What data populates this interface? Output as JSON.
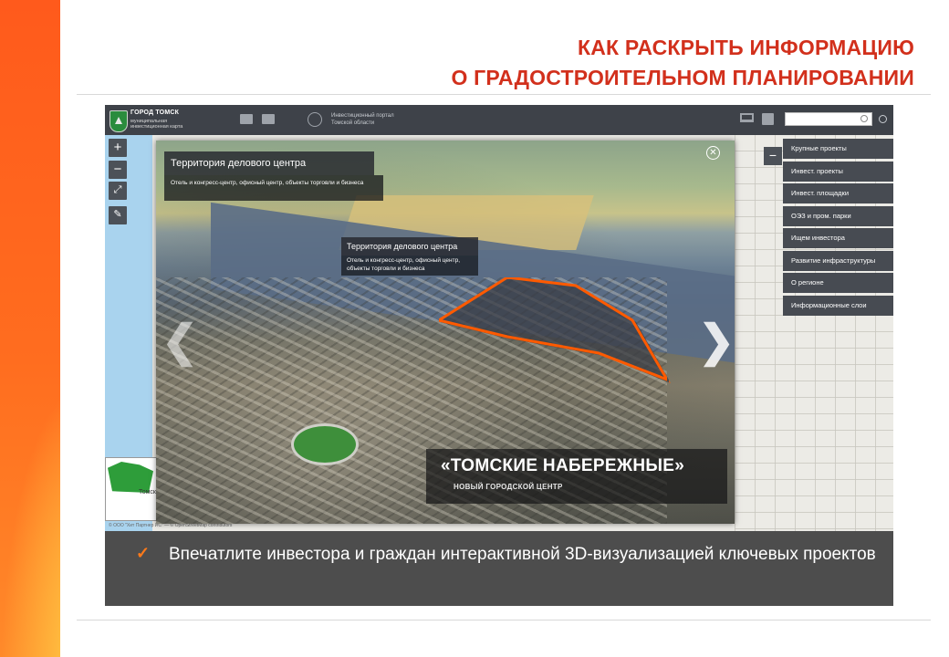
{
  "slide": {
    "title_line1": "КАК РАСКРЫТЬ  ИНФОРМАЦИЮ",
    "title_line2": "О ГРАДОСТРОИТЕЛЬНОМ  ПЛАНИРОВАНИИ",
    "accent_color": "#d2301c",
    "strip_color": "#ff6a1e",
    "callout_text": "Впечатлите инвестора и граждан интерактивной 3D-визуализацией ключевых проектов",
    "callout_icon": "check-icon"
  },
  "app": {
    "city_name": "ГОРОД ТОМСК",
    "city_subtitle": "муниципальная инвестиционная карта",
    "portal_text": "Инвестиционный портал Томской области",
    "search_placeholder": "",
    "icons": [
      "city-emblem-icon",
      "scale-icon",
      "printer-icon",
      "region-emblem-icon",
      "monitor-icon",
      "printer-icon",
      "search-icon",
      "zoom-search-icon"
    ],
    "map_controls": [
      "+",
      "−",
      "⤢",
      "✎"
    ],
    "collapse_label": "−",
    "minimap_label": "Томск",
    "attribution": "© ООО \"Хит Партнер ИС\" — © OpenStreetMap contributors",
    "menu": [
      {
        "label": "Крупные проекты"
      },
      {
        "label": "Инвест. проекты"
      },
      {
        "label": "Инвест. площадки"
      },
      {
        "label": "ОЭЗ и пром. парки"
      },
      {
        "label": "Ищем инвестора"
      },
      {
        "label": "Развитие инфраструктуры"
      },
      {
        "label": "О регионе"
      },
      {
        "label": "Информационные слои"
      }
    ]
  },
  "viewer": {
    "caption_title": "Территория делового центра",
    "caption_text": "Отель и конгресс-центр, офисный центр, объекты торговли и бизнеса",
    "tooltip_title": "Территория делового центра",
    "tooltip_text": "Отель и конгресс-центр, офисный центр, объекты торговли и бизнеса",
    "close_label": "✕",
    "prev_label": "❮",
    "next_label": "❯",
    "banner_title": "«ТОМСКИЕ НАБЕРЕЖНЫЕ»",
    "banner_subtitle": "НОВЫЙ ГОРОДСКОЙ ЦЕНТР",
    "highlight_color": "#ff5a00"
  }
}
